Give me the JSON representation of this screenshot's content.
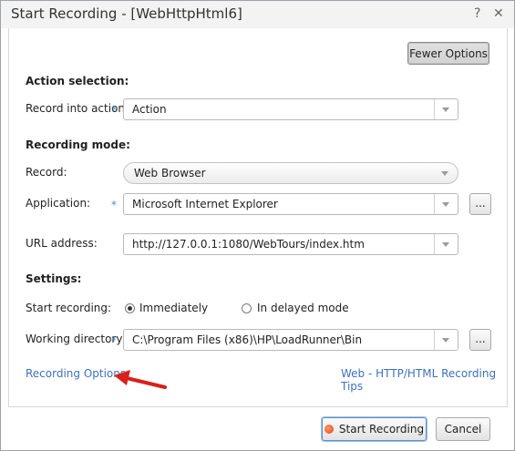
{
  "window": {
    "title": "Start Recording - [WebHttpHtml6]",
    "help_glyph": "?",
    "close_glyph": "✕"
  },
  "toolbar": {
    "fewer_options_label": "Fewer Options"
  },
  "action_selection": {
    "heading": "Action selection:",
    "record_into_label": "Record into action:",
    "record_into_value": "Action"
  },
  "recording_mode": {
    "heading": "Recording mode:",
    "record_label": "Record:",
    "record_value": "Web Browser",
    "application_label": "Application:",
    "application_value": "Microsoft Internet Explorer",
    "browse_label": "...",
    "url_label": "URL address:",
    "url_value": "http://127.0.0.1:1080/WebTours/index.htm"
  },
  "settings": {
    "heading": "Settings:",
    "start_label": "Start recording:",
    "options": [
      {
        "label": "Immediately",
        "selected": true
      },
      {
        "label": "In delayed mode",
        "selected": false
      }
    ],
    "workdir_label": "Working directory:",
    "workdir_value": "C:\\Program Files (x86)\\HP\\LoadRunner\\Bin",
    "browse_label": "..."
  },
  "required_marker": "*",
  "links": {
    "recording_options": "Recording Options",
    "tips": "Web - HTTP/HTML Recording Tips"
  },
  "footer": {
    "start_label": "Start Recording",
    "cancel_label": "Cancel"
  },
  "colors": {
    "link": "#3d73b9",
    "required": "#4a8fd8",
    "annotation_arrow": "#d9201c"
  }
}
